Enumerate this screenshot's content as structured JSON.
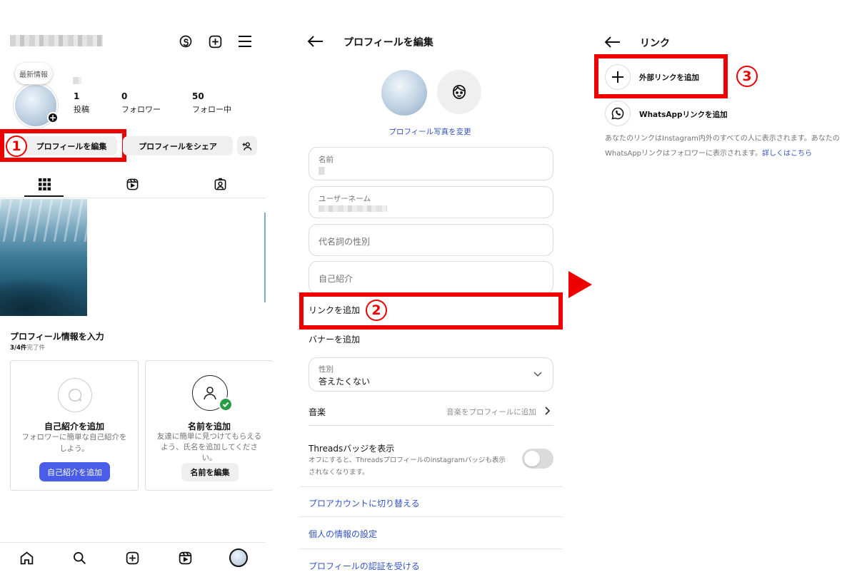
{
  "colors": {
    "accent_red": "#ee0000",
    "link_blue": "#3252c6",
    "button_blue": "#4a5de8",
    "green_check": "#2a9b47"
  },
  "panel1": {
    "story_bubble": "最新情報",
    "stats": [
      {
        "value": "1",
        "label": "投稿"
      },
      {
        "value": "0",
        "label": "フォロワー"
      },
      {
        "value": "50",
        "label": "フォロー中"
      }
    ],
    "edit_profile_label": "プロフィールを編集",
    "share_profile_label": "プロフィールをシェア",
    "step_marker": "1",
    "section_title": "プロフィール情報を入力",
    "progress_count": "3/4件",
    "progress_suffix": "完了件",
    "card_bio": {
      "title": "自己紹介を追加",
      "desc_line1": "フォロワーに簡単な自己紹介を",
      "desc_line2": "しよう。",
      "button": "自己紹介を追加"
    },
    "card_name": {
      "title": "名前を追加",
      "desc_line1": "友達に簡単に見つけてもらえる",
      "desc_line2": "よう、氏名を追加してくださ",
      "desc_line3": "い。",
      "button": "名前を編集"
    }
  },
  "panel2": {
    "title": "プロフィールを編集",
    "change_photo": "プロフィール写真を変更",
    "field_name_label": "名前",
    "field_username_label": "ユーザーネーム",
    "field_pronouns_placeholder": "代名詞の性別",
    "field_bio_placeholder": "自己紹介",
    "add_link": "リンクを追加",
    "step_marker": "2",
    "add_banner": "バナーを追加",
    "gender_label": "性別",
    "gender_value": "答えたくない",
    "music_label": "音楽",
    "music_value": "音楽をプロフィールに追加",
    "threads_title": "Threadsバッジを表示",
    "threads_desc_line1": "オフにすると、Threadsプロフィールのinstagramバッジも表示",
    "threads_desc_line2": "されなくなります。",
    "threads_toggle_on": false,
    "pro_account": "プロアカウントに切り替える",
    "personal_info": "個人の情報の設定",
    "verification": "プロフィールの認証を受ける"
  },
  "panel3": {
    "title": "リンク",
    "add_external_link": "外部リンクを追加",
    "step_marker": "3",
    "add_whatsapp_link": "WhatsAppリンクを追加",
    "info_line1": "あなたのリンクはInstagram内外のすべての人に表示されます。あなたの",
    "info_line2": "WhatsAppリンクはフォロワーに表示されます。",
    "learn_more": "詳しくはこちら"
  }
}
